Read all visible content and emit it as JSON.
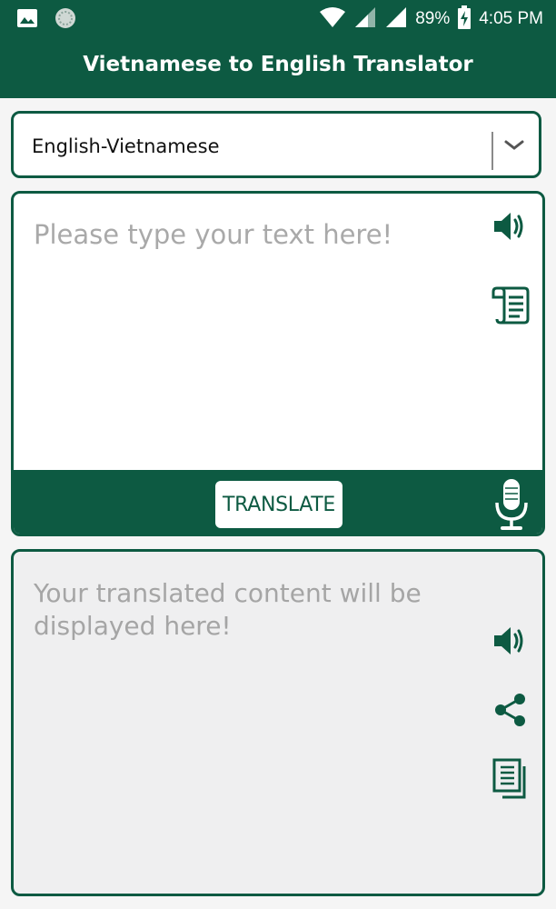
{
  "status_bar": {
    "battery": "89%",
    "time": "4:05 PM",
    "icons": [
      "image-icon",
      "app-notification-icon",
      "wifi-icon",
      "cell-signal-icon",
      "cell-signal-icon",
      "battery-charging-icon"
    ]
  },
  "app_bar": {
    "title": "Vietnamese to English Translator"
  },
  "language_selector": {
    "selected": "English-Vietnamese"
  },
  "input": {
    "placeholder": "Please type your text here!",
    "speak_icon": "speaker-icon",
    "clipboard_icon": "scroll-paste-icon"
  },
  "toolbar": {
    "translate_label": "TRANSLATE",
    "mic_icon": "microphone-icon"
  },
  "output": {
    "placeholder": "Your translated content will be displayed here!",
    "speak_icon": "speaker-icon",
    "share_icon": "share-icon",
    "copy_icon": "copy-icon"
  },
  "colors": {
    "brand": "#0d5a42",
    "placeholder_text": "#a9a9a9",
    "output_background": "#efeff0"
  }
}
